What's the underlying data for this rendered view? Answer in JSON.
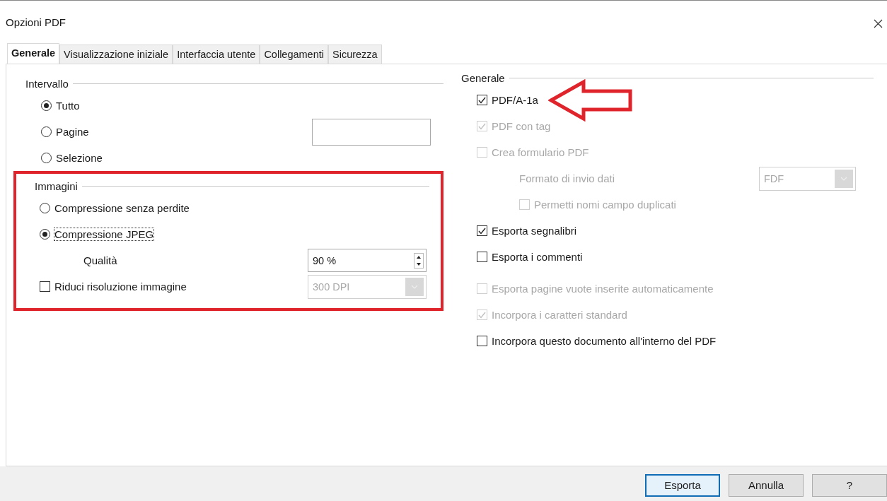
{
  "window": {
    "title": "Opzioni PDF"
  },
  "tabs": [
    {
      "label": "Generale",
      "selected": true
    },
    {
      "label": "Visualizzazione iniziale",
      "selected": false
    },
    {
      "label": "Interfaccia utente",
      "selected": false
    },
    {
      "label": "Collegamenti",
      "selected": false
    },
    {
      "label": "Sicurezza",
      "selected": false
    }
  ],
  "range": {
    "title": "Intervallo",
    "options": [
      {
        "label": "Tutto",
        "selected": true
      },
      {
        "label": "Pagine",
        "selected": false
      },
      {
        "label": "Selezione",
        "selected": false
      }
    ]
  },
  "images": {
    "title": "Immagini",
    "options": [
      {
        "label": "Compressione senza perdite",
        "selected": false
      },
      {
        "label": "Compressione JPEG",
        "selected": true
      }
    ],
    "quality": {
      "label": "Qualità",
      "value": "90 %"
    },
    "reduce": {
      "label": "Riduci risoluzione immagine",
      "checked": false,
      "value": "300 DPI",
      "disabled": true
    }
  },
  "general": {
    "title": "Generale",
    "items": [
      {
        "kind": "checkbox",
        "label": "PDF/A-1a",
        "checked": true,
        "disabled": false
      },
      {
        "kind": "checkbox",
        "label": "PDF con tag",
        "checked": true,
        "disabled": true
      },
      {
        "kind": "checkbox",
        "label": "Crea formulario PDF",
        "checked": false,
        "disabled": true,
        "children": [
          {
            "kind": "select",
            "label": "Formato di invio dati",
            "value": "FDF",
            "disabled": true
          },
          {
            "kind": "checkbox",
            "label": "Permetti nomi campo duplicati",
            "checked": false,
            "disabled": true
          }
        ]
      },
      {
        "kind": "checkbox",
        "label": "Esporta segnalibri",
        "checked": true,
        "disabled": false
      },
      {
        "kind": "checkbox",
        "label": "Esporta i commenti",
        "checked": false,
        "disabled": false
      },
      {
        "kind": "checkbox",
        "label": "Esporta pagine vuote inserite automaticamente",
        "checked": false,
        "disabled": true
      },
      {
        "kind": "checkbox",
        "label": "Incorpora i caratteri standard",
        "checked": true,
        "disabled": true
      },
      {
        "kind": "checkbox",
        "label": "Incorpora questo documento all'interno del PDF",
        "checked": false,
        "disabled": false
      }
    ]
  },
  "buttons": [
    {
      "label": "Esporta",
      "default": true
    },
    {
      "label": "Annulla",
      "default": false
    },
    {
      "label": "?",
      "default": false
    }
  ]
}
